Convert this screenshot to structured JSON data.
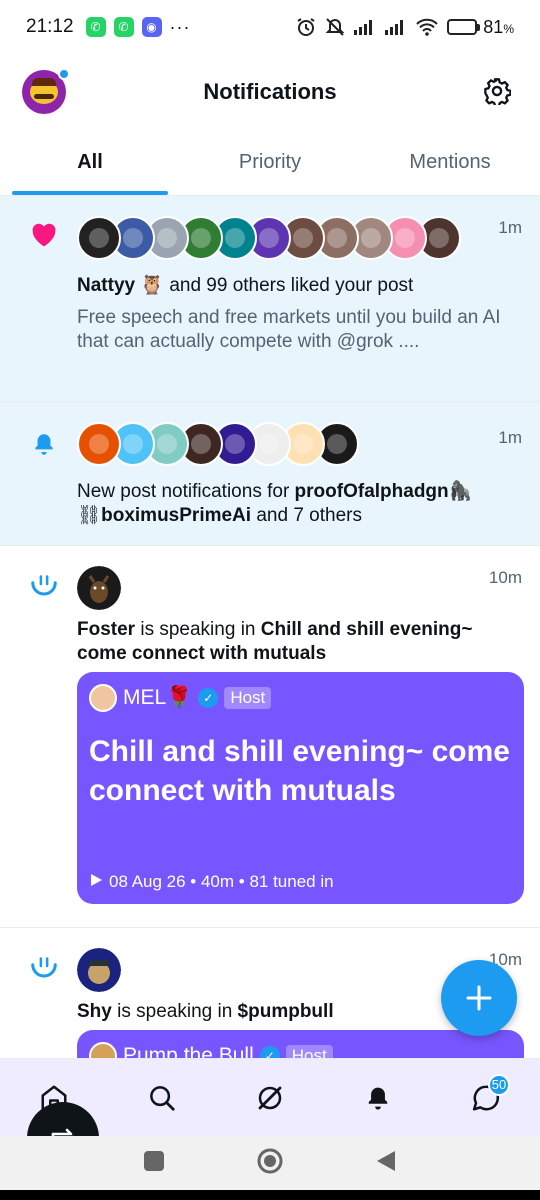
{
  "status_bar": {
    "time": "21:12",
    "more": "···",
    "battery_pct": "81",
    "battery_unit": "%",
    "battery_level": 0.81,
    "icons": [
      "whatsapp-icon",
      "whatsapp-business-icon",
      "discord-icon",
      "alarm-icon",
      "mute-icon",
      "signal-icon",
      "signal-icon",
      "wifi-icon",
      "battery-icon"
    ]
  },
  "header": {
    "title": "Notifications",
    "settings_icon": "gear-icon"
  },
  "tabs": [
    {
      "label": "All",
      "active": true
    },
    {
      "label": "Priority",
      "active": false
    },
    {
      "label": "Mentions",
      "active": false
    }
  ],
  "notifications": [
    {
      "type": "like",
      "icon": "heart-icon",
      "time": "1m",
      "actor": "Nattyy",
      "actor_suffix": "🦉",
      "text": "and 99 others liked your post",
      "preview": "Free speech and free markets until you build an AI that can actually compete with @grok ....",
      "avatar_colors": [
        "#222222",
        "#3b5ba5",
        "#9aa5b1",
        "#2e7d32",
        "#00838f",
        "#5e35b1",
        "#6d4c41",
        "#8d6e63",
        "#a1887f",
        "#f48fb1",
        "#4e342e"
      ]
    },
    {
      "type": "post_notification",
      "icon": "bell-icon",
      "time": "1m",
      "prefix": "New post notifications for",
      "name1": "proofOfalphadgn🦍",
      "name2_prefix": "⛓",
      "name2": "boximusPrimeAi",
      "suffix": "and 7 others",
      "avatar_colors": [
        "#e65100",
        "#4fc3f7",
        "#80cbc4",
        "#3e2723",
        "#311b92",
        "#eeeeee",
        "#ffe0b2",
        "#1a1a1a"
      ]
    },
    {
      "type": "space",
      "icon": "spaces-icon",
      "time": "10m",
      "actor": "Foster",
      "mid": "is speaking in",
      "space_name": "Chill and shill evening~ come connect with mutuals",
      "host_name": "MEL🌹",
      "host_label": "Host",
      "card_title": "Chill and shill evening~ come connect with mutuals",
      "card_meta": "08 Aug 26 • 40m • 81 tuned in",
      "avatar_color": "#1a1a1a"
    },
    {
      "type": "space",
      "icon": "spaces-icon",
      "time": "10m",
      "actor": "Shy",
      "mid": "is speaking in",
      "space_name": "$pumpbull",
      "host_name": "Pump the Bull",
      "host_label": "Host",
      "avatar_color": "#1a237e"
    }
  ],
  "fab": {
    "icon": "plus-icon"
  },
  "bottom_nav": {
    "items": [
      "home-icon",
      "search-icon",
      "grok-icon",
      "bell-icon",
      "messages-icon"
    ],
    "messages_badge": "50"
  }
}
